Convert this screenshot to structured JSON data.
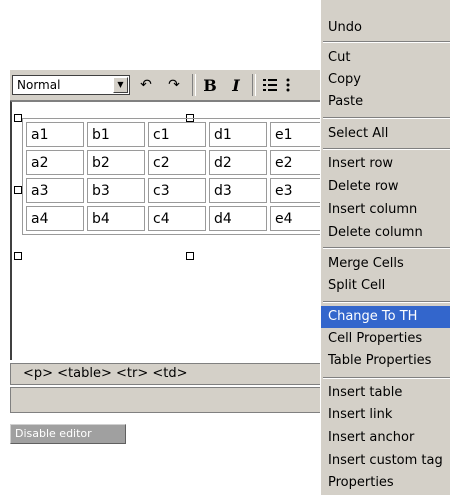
{
  "toolbar": {
    "format_value": "Normal",
    "undo_icon": "undo-icon",
    "redo_icon": "redo-icon",
    "bold_label": "B",
    "italic_label": "I"
  },
  "table": {
    "rows": [
      [
        "a1",
        "b1",
        "c1",
        "d1",
        "e1"
      ],
      [
        "a2",
        "b2",
        "c2",
        "d2",
        "e2"
      ],
      [
        "a3",
        "b3",
        "c3",
        "d3",
        "e3"
      ],
      [
        "a4",
        "b4",
        "c4",
        "d4",
        "e4"
      ]
    ]
  },
  "status": {
    "path": "<p> <table> <tr> <td>"
  },
  "disable_editor": "Disable editor",
  "context_menu": {
    "undo": "Undo",
    "cut": "Cut",
    "copy": "Copy",
    "paste": "Paste",
    "select_all": "Select All",
    "insert_row": "Insert row",
    "delete_row": "Delete row",
    "insert_column": "Insert column",
    "delete_column": "Delete column",
    "merge_cells": "Merge Cells",
    "split_cell": "Split Cell",
    "change_to_th": "Change To TH",
    "cell_properties": "Cell Properties",
    "table_properties": "Table Properties",
    "insert_table": "Insert table",
    "insert_link": "Insert link",
    "insert_anchor": "Insert anchor",
    "insert_custom_tag": "Insert custom tag",
    "properties": "Properties"
  }
}
